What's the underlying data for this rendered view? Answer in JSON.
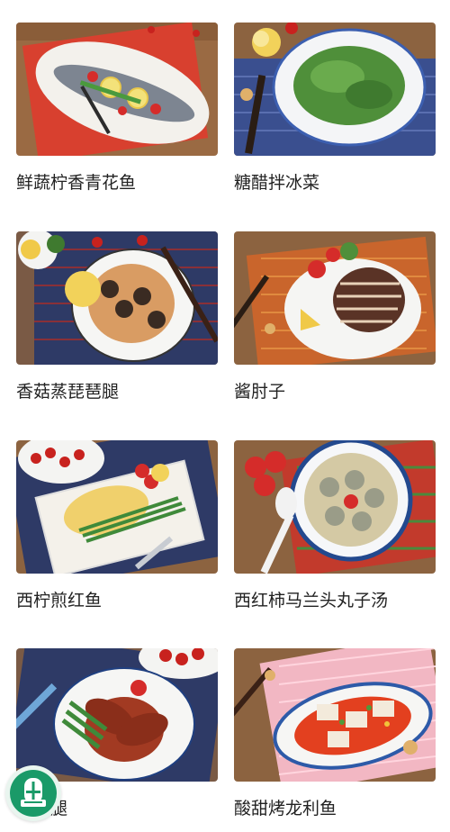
{
  "recipes": [
    {
      "name": "鲜蔬柠香青花鱼",
      "image": "mackerel-with-lemon-photo"
    },
    {
      "name": "糖醋拌冰菜",
      "image": "ice-plant-salad-photo"
    },
    {
      "name": "香菇蒸琵琶腿",
      "image": "steamed-drumstick-mushroom-photo"
    },
    {
      "name": "酱肘子",
      "image": "braised-pork-knuckle-photo"
    },
    {
      "name": "西柠煎红鱼",
      "image": "lemon-pan-fried-fish-photo"
    },
    {
      "name": "西红柿马兰头丸子汤",
      "image": "tomato-meatball-soup-photo"
    },
    {
      "name": "琵琶腿",
      "image": "braised-drumstick-photo"
    },
    {
      "name": "酸甜烤龙利鱼",
      "image": "sweet-sour-sole-fish-photo"
    }
  ],
  "floating_button": {
    "icon": "wallet-icon"
  },
  "colors": {
    "brand": "#1a9a68",
    "text": "#222222"
  }
}
